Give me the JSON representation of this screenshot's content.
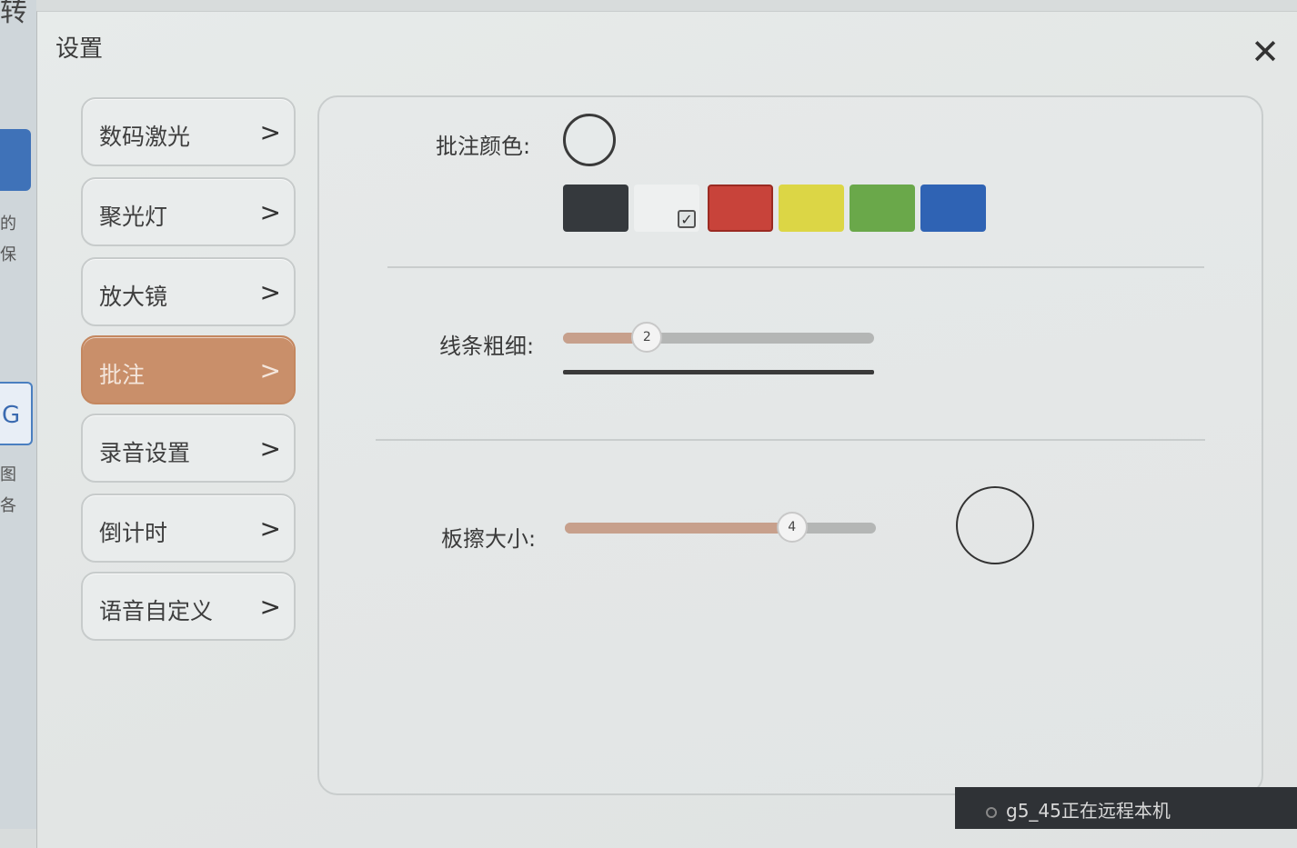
{
  "background": {
    "title_fragment": "转",
    "side_text": [
      "的",
      "保",
      "图",
      "各"
    ],
    "file_icon_letter": "G"
  },
  "dialog": {
    "title": "设置",
    "close_icon": "close-icon"
  },
  "nav": {
    "items": [
      {
        "label": "数码激光",
        "chevron": ">",
        "active": false
      },
      {
        "label": "聚光灯",
        "chevron": ">",
        "active": false
      },
      {
        "label": "放大镜",
        "chevron": ">",
        "active": false
      },
      {
        "label": "批注",
        "chevron": ">",
        "active": true
      },
      {
        "label": "录音设置",
        "chevron": ">",
        "active": false
      },
      {
        "label": "倒计时",
        "chevron": ">",
        "active": false
      },
      {
        "label": "语音自定义",
        "chevron": ">",
        "active": false
      }
    ]
  },
  "annotation": {
    "color_label": "批注颜色:",
    "swatches": [
      {
        "name": "black",
        "color": "#35393d",
        "selected": false,
        "checked": false
      },
      {
        "name": "white",
        "color": "#eef0f0",
        "selected": false,
        "checked": true
      },
      {
        "name": "red",
        "color": "#c8433a",
        "selected": true,
        "checked": false
      },
      {
        "name": "yellow",
        "color": "#dcd645",
        "selected": false,
        "checked": false
      },
      {
        "name": "green",
        "color": "#6aa84a",
        "selected": false,
        "checked": false
      },
      {
        "name": "blue",
        "color": "#2f63b4",
        "selected": false,
        "checked": false
      }
    ],
    "line_label": "线条粗细:",
    "line_value": "2",
    "line_fraction": 0.27,
    "eraser_label": "板擦大小:",
    "eraser_value": "4",
    "eraser_fraction": 0.73
  },
  "status": {
    "text": "g5_45正在远程本机"
  },
  "colors": {
    "active_nav": "#c98f6a"
  }
}
